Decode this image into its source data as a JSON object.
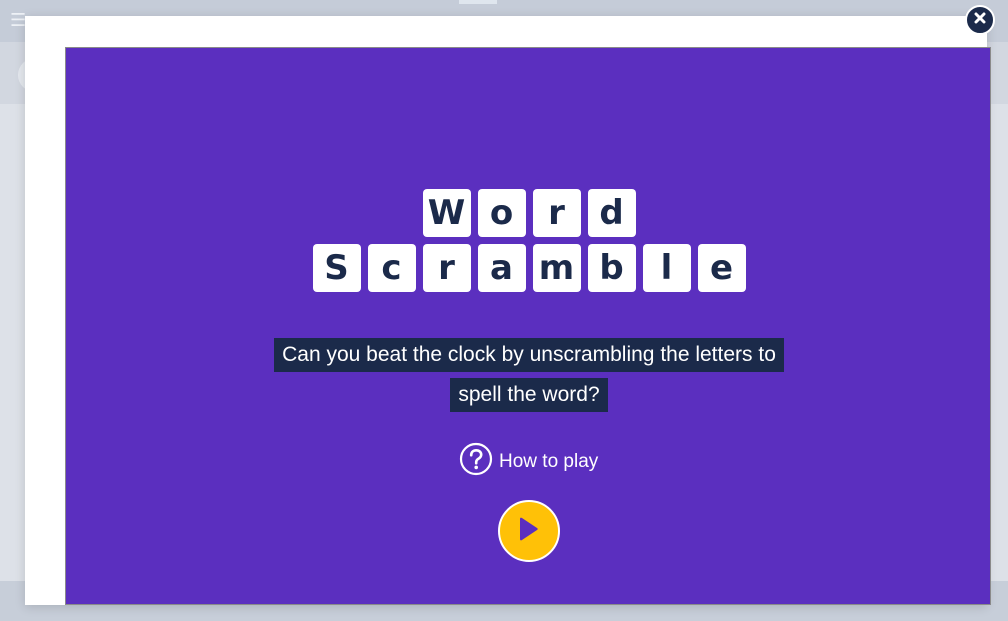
{
  "background": {
    "menu_icon": "hamburger-icon"
  },
  "modal": {
    "close_icon": "close-icon"
  },
  "game": {
    "title_words": [
      [
        "W",
        "o",
        "r",
        "d"
      ],
      [
        "S",
        "c",
        "r",
        "a",
        "m",
        "b",
        "l",
        "e"
      ]
    ],
    "description_line1": "Can you beat the clock by unscrambling the letters to",
    "description_line2": "spell the word?",
    "how_to_play_label": "How to play",
    "how_to_play_icon": "question-circle-icon",
    "play_icon": "play-icon"
  },
  "colors": {
    "game_background": "#5b2fbf",
    "tile": "#ffffff",
    "tile_text": "#1b2a4a",
    "text_highlight": "#1b2a4a",
    "play_button": "#ffc107",
    "play_arrow": "#5b2fbf",
    "close_button": "#1b2a4a"
  }
}
